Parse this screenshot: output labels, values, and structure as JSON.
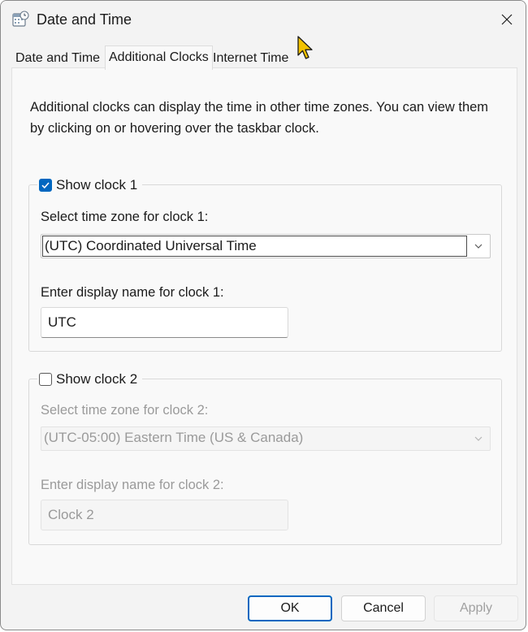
{
  "window": {
    "title": "Date and Time"
  },
  "tabs": [
    {
      "label": "Date and Time"
    },
    {
      "label": "Additional Clocks"
    },
    {
      "label": "Internet Time"
    }
  ],
  "description": "Additional clocks can display the time in other time zones. You can view them by clicking on or hovering over the taskbar clock.",
  "clock1": {
    "checkbox_label": "Show clock 1",
    "checked": true,
    "tz_label": "Select time zone for clock 1:",
    "tz_value": "(UTC) Coordinated Universal Time",
    "name_label": "Enter display name for clock 1:",
    "name_value": "UTC"
  },
  "clock2": {
    "checkbox_label": "Show clock 2",
    "checked": false,
    "tz_label": "Select time zone for clock 2:",
    "tz_value": "(UTC-05:00) Eastern Time (US & Canada)",
    "name_label": "Enter display name for clock 2:",
    "name_value": "Clock 2"
  },
  "buttons": {
    "ok": "OK",
    "cancel": "Cancel",
    "apply": "Apply"
  },
  "colors": {
    "accent": "#0067c0",
    "cursor": "#f2c200"
  }
}
